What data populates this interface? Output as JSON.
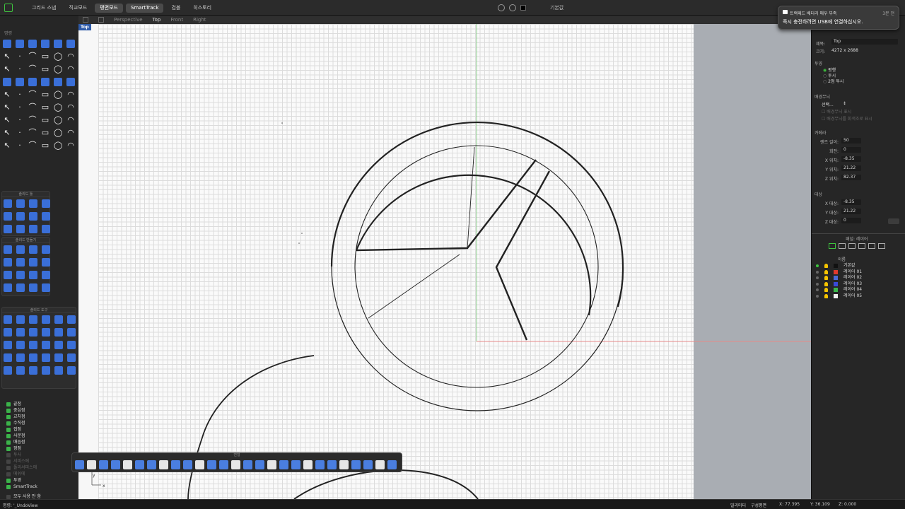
{
  "topbar": {
    "tabs": [
      "그리드 스냅",
      "직교모드",
      "평면모드",
      "SmartTrack",
      "검볼",
      "히스토리"
    ],
    "active_tabs": [
      2,
      3
    ],
    "current_layer": "기본값"
  },
  "viewport_tabs": [
    "Perspective",
    "Top",
    "Front",
    "Right"
  ],
  "active_viewport": "Top",
  "viewport_label": "Top",
  "left_panel": {
    "main_header": "명령",
    "solid_tools_header": "솔리드 툴",
    "solid_create_header": "솔리드 만들기",
    "solid_edit_header": "솔리드 도구",
    "osnaps": [
      {
        "label": "끝점",
        "on": true
      },
      {
        "label": "중심점",
        "on": true
      },
      {
        "label": "교차점",
        "on": true
      },
      {
        "label": "수직점",
        "on": true
      },
      {
        "label": "접점",
        "on": true
      },
      {
        "label": "사분점",
        "on": true
      },
      {
        "label": "매듭점",
        "on": true
      },
      {
        "label": "정점",
        "on": true
      },
      {
        "label": "투사",
        "on": false
      },
      {
        "label": "서피스에",
        "on": false
      },
      {
        "label": "폴리서피스에",
        "on": false
      },
      {
        "label": "메쉬에",
        "on": false
      },
      {
        "label": "투영",
        "on": true
      },
      {
        "label": "SmartTrack",
        "on": true
      }
    ],
    "disable_all": "모두 사용 안 함"
  },
  "command_toolbar_title": "변형",
  "right_panel": {
    "title_label": "제목:",
    "title_value": "Top",
    "size_label": "크기:",
    "size_value": "4272 x 2688",
    "projection_header": "투영",
    "projection_options": [
      "평행",
      "투시",
      "2점 투시"
    ],
    "background_header": "배경무늬",
    "background_select": "선택...",
    "background_opt1": "배경무늬 표시",
    "background_opt2": "배경무늬를 회색조로 표시",
    "camera_header": "카메라",
    "camera": [
      {
        "label": "렌즈 길이:",
        "value": "50"
      },
      {
        "label": "회전:",
        "value": "0"
      },
      {
        "label": "X 위치:",
        "value": "-8.35"
      },
      {
        "label": "Y 위치:",
        "value": "21.22"
      },
      {
        "label": "Z 위치:",
        "value": "82.37"
      }
    ],
    "target_header": "대상",
    "target": [
      {
        "label": "X 대상:",
        "value": "-8.35"
      },
      {
        "label": "Y 대상:",
        "value": "21.22"
      },
      {
        "label": "Z 대상:",
        "value": "0"
      }
    ],
    "layers_panel_title": "패널: 레이어",
    "layers_col_name": "이름",
    "layers": [
      {
        "name": "기본값",
        "color": "#111111",
        "current": true
      },
      {
        "name": "레이어 01",
        "color": "#e03a2e",
        "current": false
      },
      {
        "name": "레이어 02",
        "color": "#4a6ad8",
        "current": false
      },
      {
        "name": "레이어 03",
        "color": "#3a4ad8",
        "current": false
      },
      {
        "name": "레이어 04",
        "color": "#3ab84a",
        "current": false
      },
      {
        "name": "레이어 05",
        "color": "#f0f0f0",
        "current": false
      }
    ]
  },
  "notification": {
    "title": "트랙패드 배터리 매우 부족",
    "message": "즉시 충전하려면 USB에 연결하십시오.",
    "time": "3분 전"
  },
  "statusbar": {
    "command": "명령: '_UndoView",
    "units": "밀리미터",
    "mode": "구성평면",
    "x": "X: 77.395",
    "y": "Y: 36.109",
    "z": "Z: 0.000"
  },
  "axis_labels": {
    "y": "y",
    "x": "x"
  }
}
